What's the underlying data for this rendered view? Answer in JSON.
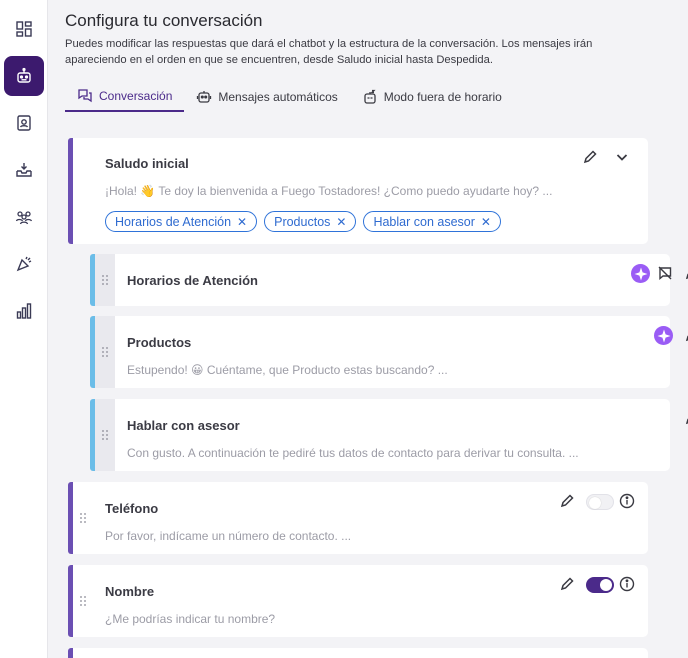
{
  "sidebar": {
    "items": [
      {
        "icon": "dashboard-icon"
      },
      {
        "icon": "bot-icon",
        "active": true
      },
      {
        "icon": "contact-book-icon"
      },
      {
        "icon": "inbox-download-icon"
      },
      {
        "icon": "users-icon"
      },
      {
        "icon": "campaign-icon"
      },
      {
        "icon": "bar-chart-icon"
      }
    ]
  },
  "header": {
    "title": "Configura tu conversación",
    "description": "Puedes modificar las respuestas que dará el chatbot y la estructura de la conversación. Los mensajes irán apareciendo en el orden en que se encuentren, desde Saludo inicial hasta Despedida."
  },
  "tabs": [
    {
      "label": "Conversación",
      "icon": "chat-bubbles-icon",
      "active": true
    },
    {
      "label": "Mensajes automáticos",
      "icon": "robot-icon",
      "active": false
    },
    {
      "label": "Modo fuera de horario",
      "icon": "robot-sleep-icon",
      "active": false
    }
  ],
  "cards": {
    "saludo": {
      "title": "Saludo inicial",
      "text": "¡Hola! 👋 Te doy la bienvenida a Fuego Tostadores! ¿Como puedo ayudarte hoy? ...",
      "chips": [
        "Horarios de Atención",
        "Productos",
        "Hablar con asesor"
      ]
    },
    "horarios": {
      "title": "Horarios de Atención"
    },
    "productos": {
      "title": "Productos",
      "text": "Estupendo! 😀 Cuéntame, que Producto estas buscando? ..."
    },
    "asesor": {
      "title": "Hablar con asesor",
      "text": "Con gusto. A continuación te pediré tus datos de contacto para derivar tu consulta. ..."
    },
    "telefono": {
      "title": "Teléfono",
      "text": "Por favor, indícame un número de contacto. ...",
      "required": false
    },
    "nombre": {
      "title": "Nombre",
      "text": "¿Me podrías indicar tu nombre?",
      "required": true
    }
  },
  "colors": {
    "accent": "#4b2a8a",
    "sidebar_active": "#3c1a6e",
    "chip_blue": "#2f6bd0",
    "bar_purple": "#6b4fb3",
    "bar_blue": "#6bbde8",
    "ai_purple": "#9a5cf5"
  }
}
